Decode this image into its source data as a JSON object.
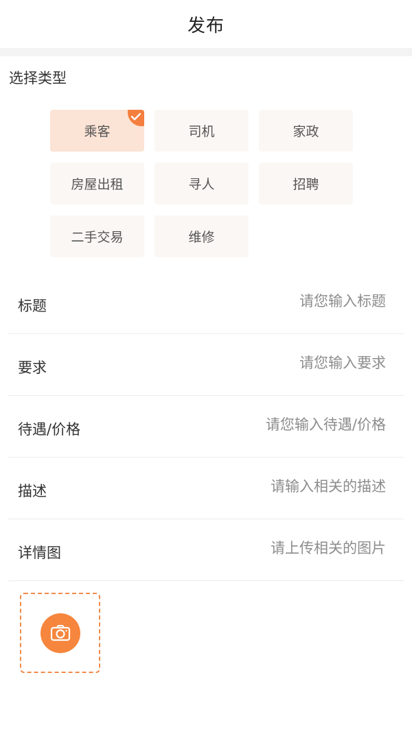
{
  "header": {
    "title": "发布"
  },
  "type_section": {
    "title": "选择类型",
    "selected_index": 0,
    "types": [
      {
        "label": "乘客"
      },
      {
        "label": "司机"
      },
      {
        "label": "家政"
      },
      {
        "label": "房屋出租"
      },
      {
        "label": "寻人"
      },
      {
        "label": "招聘"
      },
      {
        "label": "二手交易"
      },
      {
        "label": "维修"
      }
    ]
  },
  "form": {
    "title": {
      "label": "标题",
      "placeholder": "请您输入标题",
      "value": ""
    },
    "requirement": {
      "label": "要求",
      "placeholder": "请您输入要求",
      "value": ""
    },
    "price": {
      "label": "待遇/价格",
      "placeholder": "请您输入待遇/价格",
      "value": ""
    },
    "description": {
      "label": "描述",
      "placeholder": "请输入相关的描述",
      "value": ""
    },
    "detail_image": {
      "label": "详情图",
      "placeholder": "请上传相关的图片",
      "value": ""
    }
  },
  "upload": {
    "icon": "camera-icon"
  },
  "colors": {
    "accent": "#f6863d",
    "chip_bg": "#fbf7f4",
    "chip_selected_bg": "#fbe3d5",
    "divider": "#ececec"
  }
}
